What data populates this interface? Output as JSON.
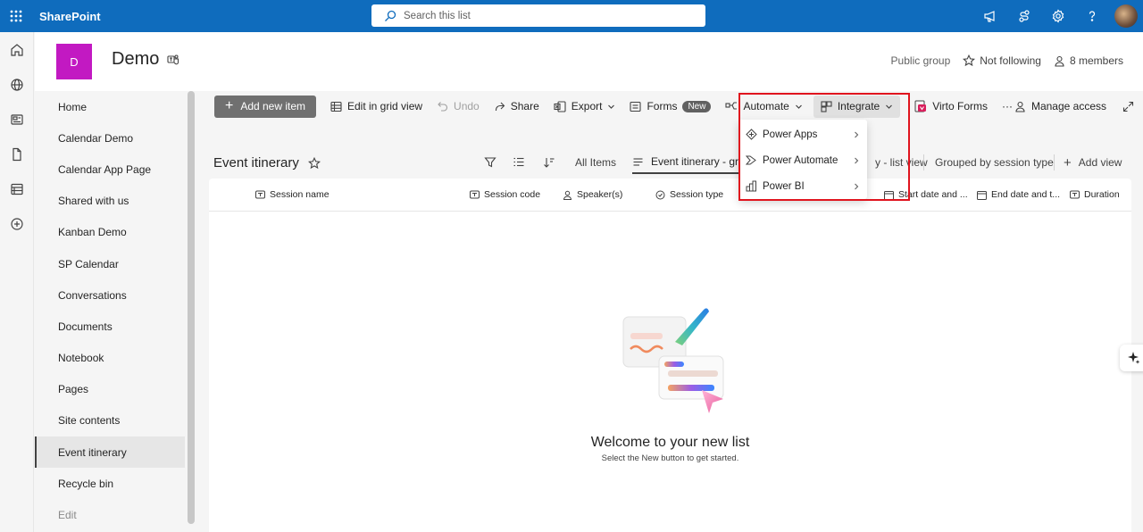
{
  "topbar": {
    "brand": "SharePoint",
    "search_placeholder": "Search this list"
  },
  "site": {
    "logo_letter": "D",
    "title": "Demo",
    "privacy": "Public group",
    "follow": "Not following",
    "members": "8 members"
  },
  "leftnav": {
    "items": [
      {
        "label": "Home"
      },
      {
        "label": "Calendar Demo"
      },
      {
        "label": "Calendar App Page"
      },
      {
        "label": "Shared with us"
      },
      {
        "label": "Kanban Demo"
      },
      {
        "label": "SP Calendar"
      },
      {
        "label": "Conversations"
      },
      {
        "label": "Documents"
      },
      {
        "label": "Notebook"
      },
      {
        "label": "Pages"
      },
      {
        "label": "Site contents"
      },
      {
        "label": "Event itinerary"
      },
      {
        "label": "Recycle bin"
      },
      {
        "label": "Edit"
      }
    ]
  },
  "cmdbar": {
    "add_new_item": "Add new item",
    "edit_grid": "Edit in grid view",
    "undo": "Undo",
    "share": "Share",
    "export": "Export",
    "forms": "Forms",
    "forms_badge": "New",
    "automate": "Automate",
    "integrate": "Integrate",
    "virto_forms": "Virto Forms",
    "more": "···",
    "manage_access": "Manage access"
  },
  "list": {
    "title": "Event itinerary",
    "views": {
      "all_items": "All Items",
      "active_view": "Event itinerary - gr",
      "list_view": "y - list view",
      "grouped": "Grouped by session type",
      "add_view": "Add view"
    },
    "columns": [
      "Session name",
      "Session code",
      "Speaker(s)",
      "Session type",
      "Start date and ...",
      "End date and t...",
      "Duration"
    ],
    "empty_title": "Welcome to your new list",
    "empty_sub": "Select the New button to get started."
  },
  "integrate_menu": {
    "items": [
      {
        "label": "Power Apps"
      },
      {
        "label": "Power Automate"
      },
      {
        "label": "Power BI"
      }
    ]
  },
  "colors": {
    "brand": "#0f6cbd",
    "site_logo": "#c219c2",
    "highlight": "#e0141e"
  }
}
